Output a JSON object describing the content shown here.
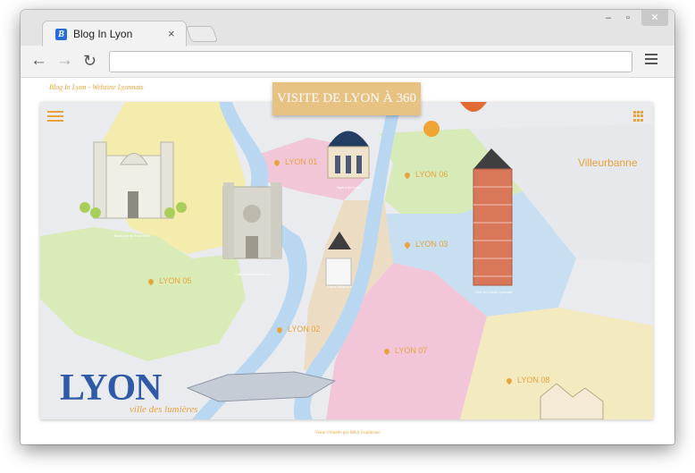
{
  "browser": {
    "tab_title": "Blog In Lyon",
    "favicon_letter": "B",
    "tab_close": "×",
    "controls": {
      "minimize": "–",
      "maximize": "▫",
      "close": "✕"
    },
    "nav": {
      "back": "←",
      "forward": "→",
      "reload": "↻"
    },
    "address_value": ""
  },
  "page": {
    "brand": "Blog In Lyon - Webzine Lyonnais",
    "cta_label": "VISITE DE LYON À 360",
    "footer": "Visite Virtuelle par MKS Graphisme",
    "lyon_title": "LYON",
    "lyon_subtitle": "ville des lumières",
    "villeurbanne": "Villeurbanne",
    "markers": [
      "LYON 01",
      "LYON 06",
      "LYON 03",
      "LYON 05",
      "LYON 02",
      "LYON 07",
      "LYON 08"
    ],
    "landmarks": [
      "Basilique de Fourvière",
      "Cathédrale Saint-Jean",
      "Opéra de Lyon",
      "Place Bellecour",
      "Tour du Crédit Lyonnais"
    ]
  },
  "colors": {
    "accent": "#e8a33b",
    "cta_bg": "#e8c283",
    "river": "#b9d7f1",
    "lyon_title": "#2e5aa8"
  }
}
